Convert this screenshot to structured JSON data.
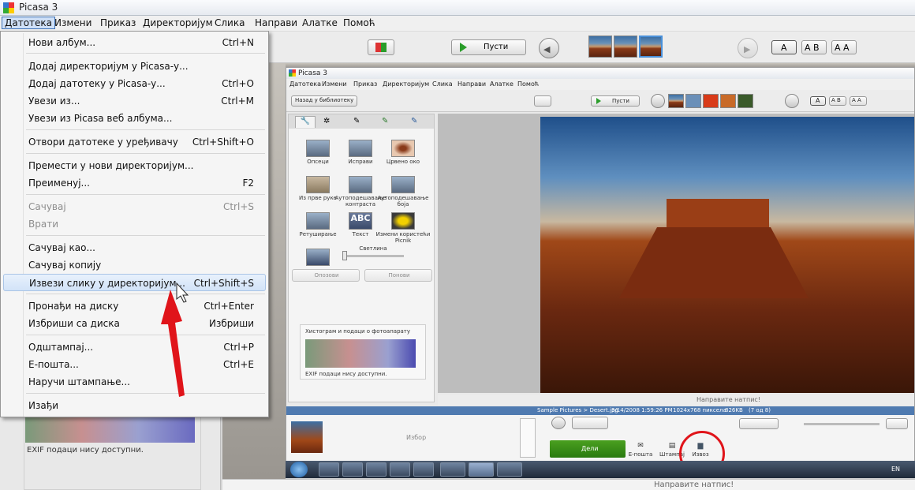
{
  "window_title": "Picasa 3",
  "menubar": [
    "Датотека",
    "Измени",
    "Приказ",
    "Директоријум",
    "Слика",
    "Направи",
    "Алатке",
    "Помоћ"
  ],
  "toolbar": {
    "play_label": "Пусти",
    "text_buttons": [
      "A",
      "A B",
      "A A"
    ]
  },
  "file_menu": {
    "items": [
      {
        "label": "Нови албум...",
        "shortcut": "Ctrl+N",
        "enabled": true
      },
      {
        "label": "Додај директоријум у Picasa-у...",
        "shortcut": "",
        "enabled": true
      },
      {
        "label": "Додај датотеку у Picasa-у...",
        "shortcut": "Ctrl+O",
        "enabled": true
      },
      {
        "label": "Увези из...",
        "shortcut": "Ctrl+M",
        "enabled": true
      },
      {
        "label": "Увези из Picasa веб албума...",
        "shortcut": "",
        "enabled": true
      },
      {
        "label": "Отвори датотеке у уређивачу",
        "shortcut": "Ctrl+Shift+O",
        "enabled": true
      },
      {
        "label": "Премести у нови директоријум...",
        "shortcut": "",
        "enabled": true
      },
      {
        "label": "Преименуј...",
        "shortcut": "F2",
        "enabled": true
      },
      {
        "label": "Сачувај",
        "shortcut": "Ctrl+S",
        "enabled": false
      },
      {
        "label": "Врати",
        "shortcut": "",
        "enabled": false
      },
      {
        "label": "Сачувај као...",
        "shortcut": "",
        "enabled": true
      },
      {
        "label": "Сачувај копију",
        "shortcut": "",
        "enabled": true
      },
      {
        "label": "Извези слику у директоријум...",
        "shortcut": "Ctrl+Shift+S",
        "enabled": true,
        "highlighted": true
      },
      {
        "label": "Пронађи на диску",
        "shortcut": "Ctrl+Enter",
        "enabled": true
      },
      {
        "label": "Избриши са диска",
        "shortcut": "Избриши",
        "enabled": true
      },
      {
        "label": "Одштампај...",
        "shortcut": "Ctrl+P",
        "enabled": true
      },
      {
        "label": "Е-пошта...",
        "shortcut": "Ctrl+E",
        "enabled": true
      },
      {
        "label": "Наручи штампање...",
        "shortcut": "",
        "enabled": true
      },
      {
        "label": "Изађи",
        "shortcut": "",
        "enabled": true
      }
    ]
  },
  "left_panel": {
    "exif_text": "EXIF подаци нису доступни."
  },
  "bottom_caption": "Направите натпис!",
  "inner": {
    "title": "Picasa 3",
    "menubar": [
      "Датотека",
      "Измени",
      "Приказ",
      "Директоријум",
      "Слика",
      "Направи",
      "Алатке",
      "Помоћ"
    ],
    "back_label": "Назад у библиотеку",
    "play_label": "Пусти",
    "text_buttons": [
      "A",
      "A B",
      "A A"
    ],
    "tools": [
      "Опсеци",
      "Исправи",
      "Црвено око",
      "Из прве руке",
      "Аутоподешавање контраста",
      "Аутоподешавање боја",
      "Ретуширање",
      "Текст",
      "Измени користећи Picnik"
    ],
    "brightness_label": "Светлина",
    "undo_label": "Опозови",
    "redo_label": "Понови",
    "histogram_title": "Хистограм и подаци о фотоапарату",
    "exif_text": "EXIF подаци нису доступни.",
    "caption": "Направите натпис!",
    "status_path": "Sample Pictures > Desert.jpg",
    "status_date": "3/14/2008 1:59:26 PM",
    "status_res": "1024x768 пиксела",
    "status_size": "826KB",
    "status_count": "(7 од 8)",
    "tray_label": "Избор",
    "share_label": "Дели",
    "email_label": "Е-пошта",
    "print_label": "Штампај",
    "export_label": "Извоз",
    "lang": "EN"
  }
}
